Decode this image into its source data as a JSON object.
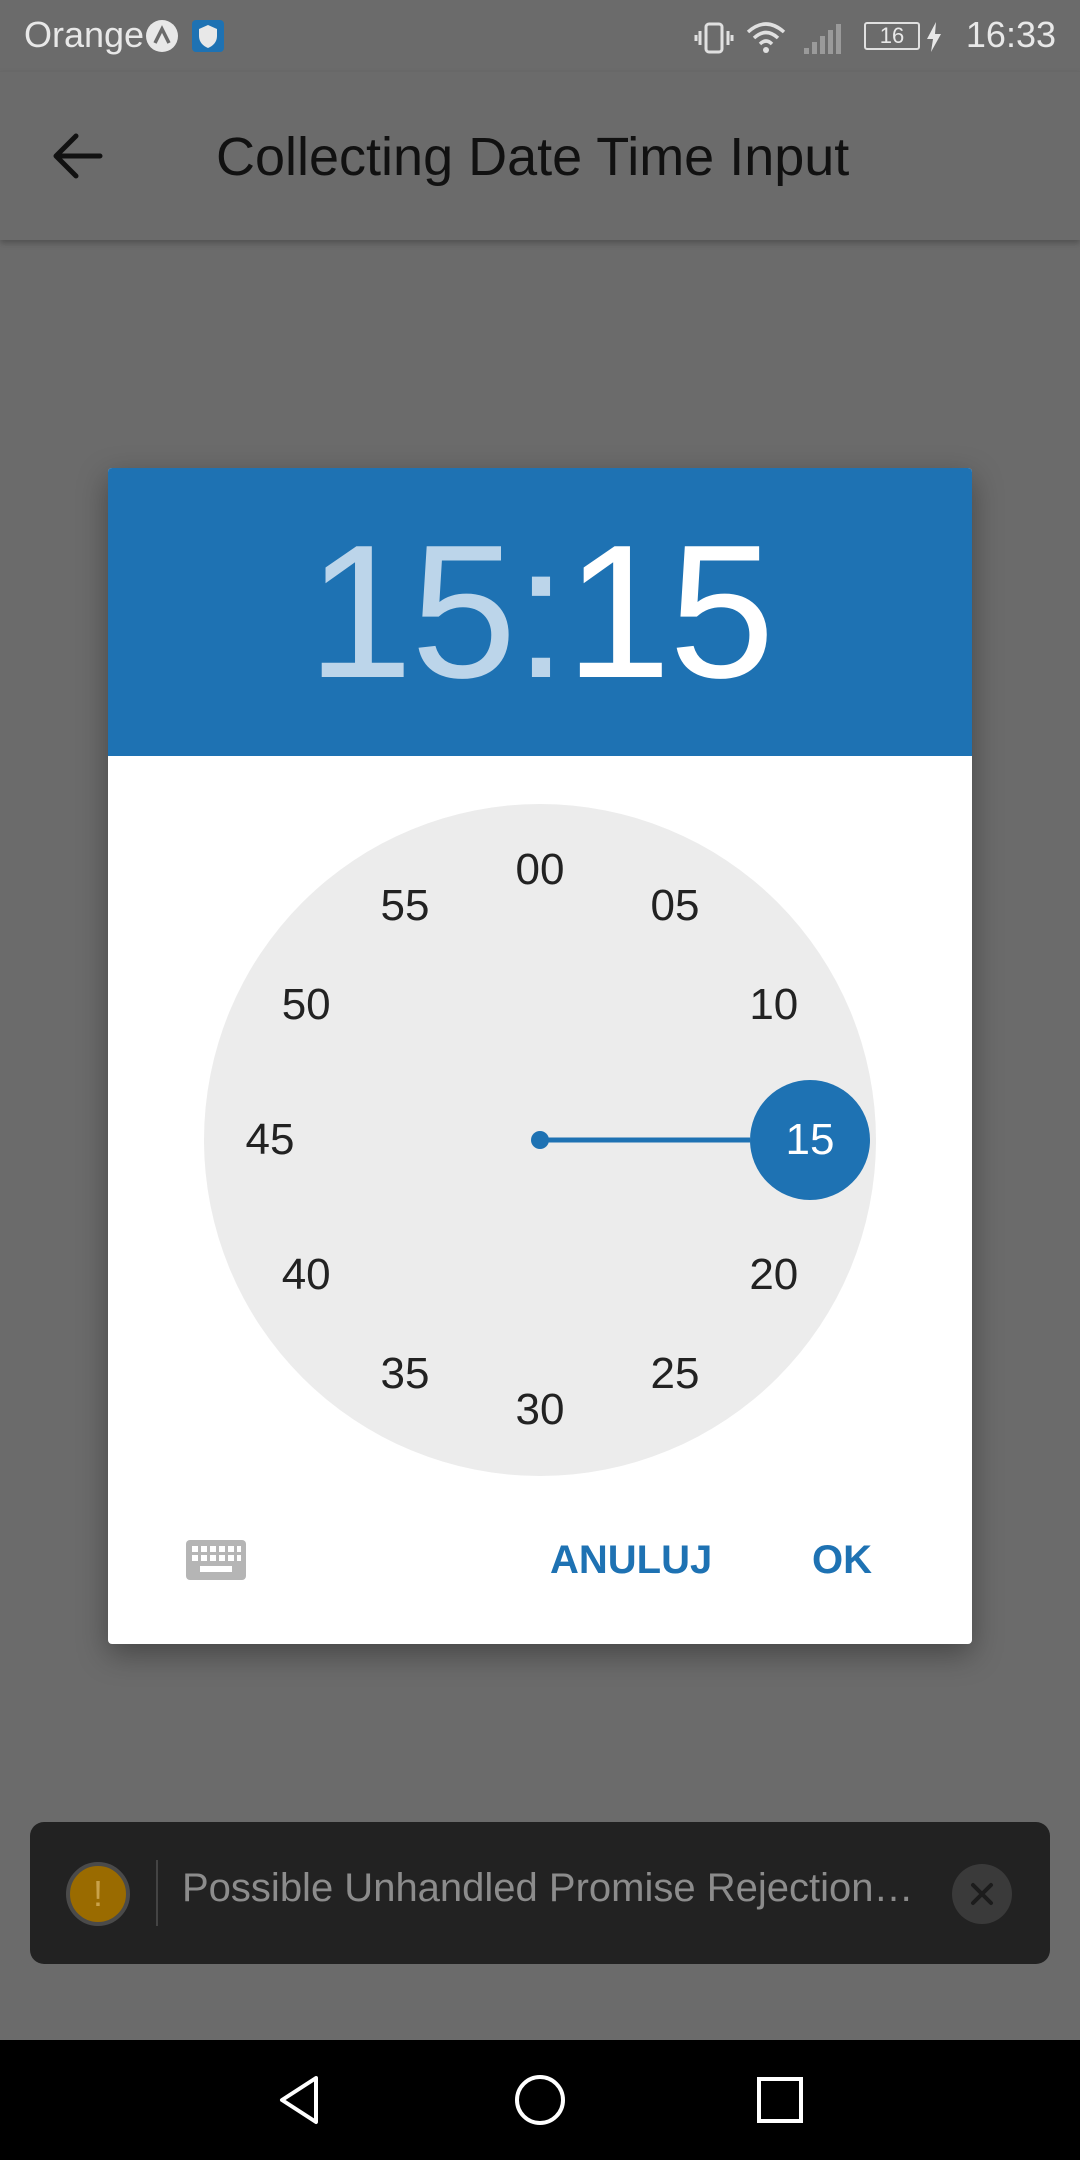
{
  "status_bar": {
    "carrier": "Orange",
    "battery": "16",
    "time": "16:33",
    "icons": [
      "a-icon",
      "shield-icon",
      "vibrate-icon",
      "wifi-icon",
      "signal-icon",
      "battery-icon",
      "charging-icon"
    ]
  },
  "app_bar": {
    "title": "Collecting Date Time Input",
    "back_icon": "arrow-left-icon"
  },
  "dialog": {
    "time_hours": "15",
    "time_separator": ":",
    "time_minutes": "15",
    "selected_minute": 15,
    "clock_numbers": [
      "00",
      "05",
      "10",
      "15",
      "20",
      "25",
      "30",
      "35",
      "40",
      "45",
      "50",
      "55"
    ],
    "cancel_label": "ANULUJ",
    "ok_label": "OK",
    "keyboard_icon": "keyboard-icon",
    "accent_color": "#1e72b3"
  },
  "toast": {
    "text": "Possible Unhandled Promise Rejection…",
    "warning_icon": "warning-icon",
    "close_icon": "close-icon"
  },
  "nav_bar": {
    "icons": [
      "nav-back-icon",
      "nav-home-icon",
      "nav-recent-icon"
    ]
  }
}
